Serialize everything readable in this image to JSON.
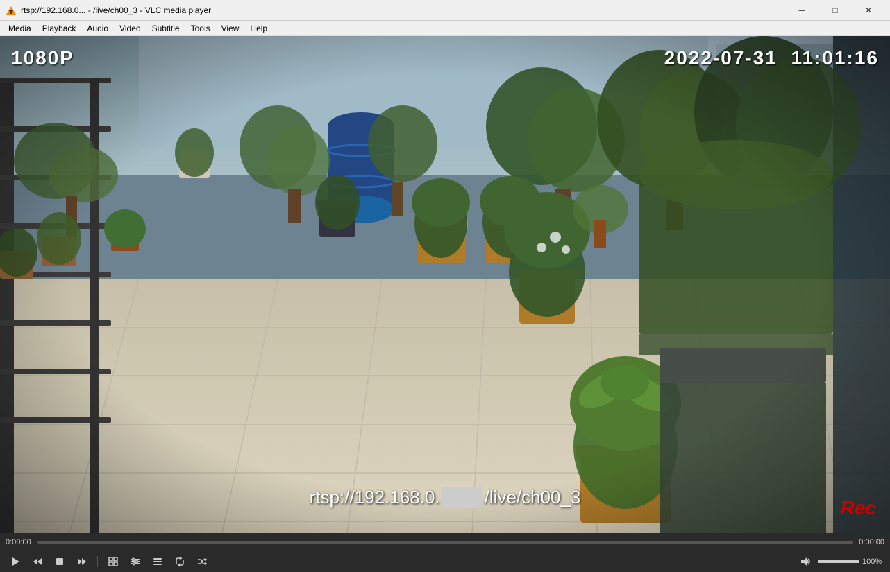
{
  "titlebar": {
    "title": "rtsp://192.168.0... - /live/ch00_3 - VLC media player",
    "minimize_label": "─",
    "maximize_label": "□",
    "close_label": "✕"
  },
  "menubar": {
    "items": [
      "Media",
      "Playback",
      "Audio",
      "Video",
      "Subtitle",
      "Tools",
      "View",
      "Help"
    ]
  },
  "video": {
    "resolution": "1080P",
    "date": "2022-07-31",
    "time": "11:01:16",
    "url_prefix": "rtsp://192.168.0.",
    "url_suffix": "/live/ch00_3",
    "rec_label": "Rec"
  },
  "progress": {
    "time_start": "0:00:00",
    "time_end": "0:00:00"
  },
  "controls": {
    "play_icon": "play",
    "prev_icon": "prev",
    "stop_icon": "stop",
    "next_icon": "next",
    "fullscreen_icon": "fullscreen",
    "extended_icon": "extended",
    "playlist_icon": "playlist",
    "loop_icon": "loop",
    "random_icon": "random",
    "volume_pct": "100%",
    "volume_fill": 100
  }
}
